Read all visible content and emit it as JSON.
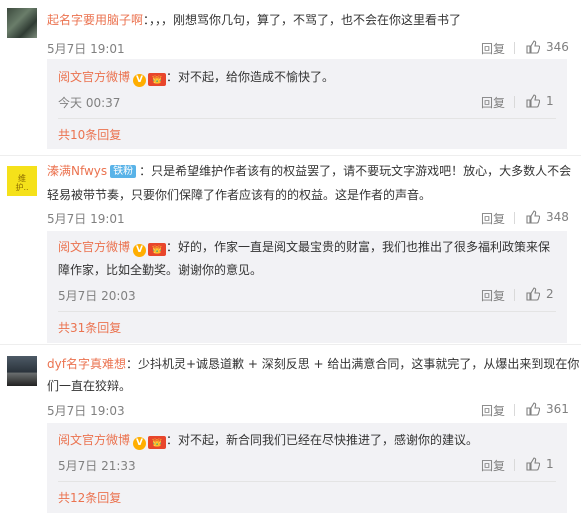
{
  "comments": [
    {
      "user": "起名字要用脑子啊",
      "badge": "",
      "lines": [
        "：，，，刚想骂你几句，算了，不骂了，也不会在你这里看书了"
      ],
      "time": "5月7日 19:01",
      "reply_label": "回复",
      "likes": "346",
      "sub": {
        "user": "阅文官方微博",
        "vip_icon": "V",
        "level_icon": "👑",
        "lines": [
          "：对不起，给你造成不愉快了。"
        ],
        "time": "今天 00:37",
        "reply_label": "回复",
        "likes": "1",
        "more": "共10条回复"
      }
    },
    {
      "user": "溱满Nfwys",
      "badge": "铁粉",
      "lines": [
        "：只是希望维护作者该有的权益罢了，请不要玩文字游戏吧！放心，大多数人不会",
        "轻易被带节奏，只要你们保障了作者应该有的的权益。这是作者的声音。"
      ],
      "time": "5月7日 19:01",
      "reply_label": "回复",
      "likes": "348",
      "avatar_text": [
        "维",
        "护.."
      ],
      "sub": {
        "user": "阅文官方微博",
        "vip_icon": "V",
        "level_icon": "👑",
        "lines": [
          "：好的，作家一直是阅文最宝贵的财富，我们也推出了很多福利政策来保",
          "障作家，比如全勤奖。谢谢你的意见。"
        ],
        "time": "5月7日 20:03",
        "reply_label": "回复",
        "likes": "2",
        "more": "共31条回复"
      }
    },
    {
      "user": "dyf名字真难想",
      "badge": "",
      "lines": [
        "：少抖机灵+诚恳道歉 + 深刻反思 + 给出满意合同，这事就完了，从爆出来到现在你",
        "们一直在狡辩。"
      ],
      "time": "5月7日 19:03",
      "reply_label": "回复",
      "likes": "361",
      "sub": {
        "user": "阅文官方微博",
        "vip_icon": "V",
        "level_icon": "👑",
        "lines": [
          "：对不起，新合同我们已经在尽快推进了，感谢你的建议。"
        ],
        "time": "5月7日 21:33",
        "reply_label": "回复",
        "likes": "1",
        "more": "共12条回复"
      }
    }
  ],
  "colors": {
    "link": "#eb7350",
    "meta": "#808080",
    "sub_bg": "#f2f2f5"
  }
}
